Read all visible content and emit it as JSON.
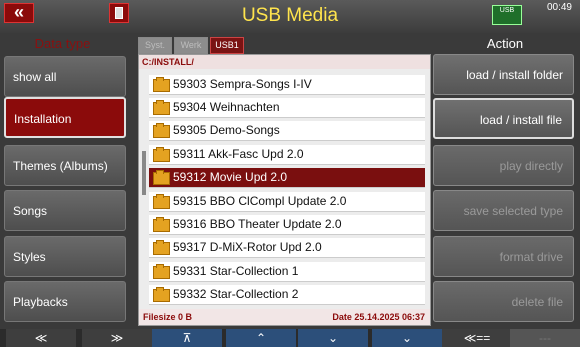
{
  "header": {
    "title": "USB Media",
    "time": "00:49",
    "back_label": "«",
    "usb_label": "USB"
  },
  "left": {
    "title": "Data type",
    "items": [
      {
        "label": "show all"
      },
      {
        "label": "Installation"
      },
      {
        "label": "Themes (Albums)"
      },
      {
        "label": "Songs"
      },
      {
        "label": "Styles"
      },
      {
        "label": "Playbacks"
      }
    ]
  },
  "tabs": [
    {
      "label": "Syst."
    },
    {
      "label": "Werk"
    },
    {
      "label": "USB1"
    }
  ],
  "panel": {
    "path": "C:/INSTALL/",
    "rows": [
      {
        "label": "59303 Sempra-Songs I-IV"
      },
      {
        "label": "59304 Weihnachten"
      },
      {
        "label": "59305 Demo-Songs"
      },
      {
        "label": "59311 Akk-Fasc Upd 2.0"
      },
      {
        "label": "59312 Movie Upd 2.0"
      },
      {
        "label": "59315 BBO ClCompl Update 2.0"
      },
      {
        "label": "59316 BBO Theater Update 2.0"
      },
      {
        "label": "59317 D-MiX-Rotor Upd 2.0"
      },
      {
        "label": "59331 Star-Collection 1"
      },
      {
        "label": "59332 Star-Collection 2"
      }
    ],
    "filesize": "Filesize 0 B",
    "date": "Date 25.14.2025  06:37"
  },
  "right": {
    "title": "Action",
    "items": [
      {
        "label": "load  /  install folder"
      },
      {
        "label": "load  /  install file"
      },
      {
        "label": "play directly"
      },
      {
        "label": "save  selected  type"
      },
      {
        "label": "format  drive"
      },
      {
        "label": "delete  file"
      }
    ]
  },
  "bottom": {
    "nav": [
      "≪",
      "≫",
      "⊼",
      "⌃",
      "⌄",
      "⌄",
      "≪==",
      "---"
    ]
  },
  "colors": {
    "accent": "#8b0b0b",
    "title": "#ffe44d"
  }
}
